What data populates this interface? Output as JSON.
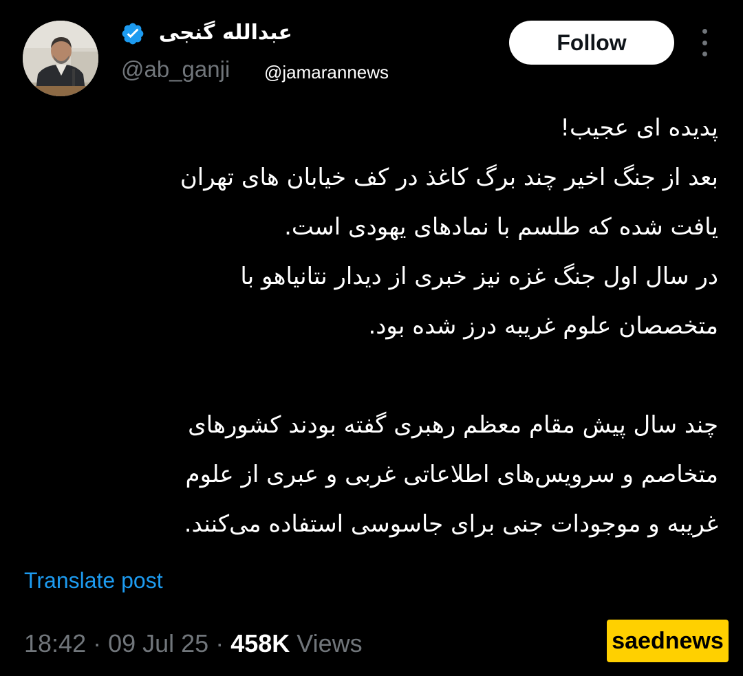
{
  "author": {
    "display_name": "عبدالله گنجی",
    "handle": "@ab_ganji",
    "avatar_icon": "profile-photo",
    "verified_icon": "verified-badge-icon"
  },
  "source_watermark": "@jamarannews",
  "actions": {
    "follow_label": "Follow",
    "more_icon": "more-vertical-icon"
  },
  "tweet": {
    "paragraph_1": "پدیده ای عجیب!\nبعد از جنگ اخیر چند برگ کاغذ در کف خیابان های تهران\nیافت شده که طلسم با نمادهای یهودی است.\nدر سال اول جنگ غزه نیز خبری از دیدار نتانیاهو با\nمتخصصان علوم غریبه درز شده بود.",
    "paragraph_2": "چند سال پیش مقام معظم رهبری گفته بودند کشورهای\nمتخاصم و سرویس‌های اطلاعاتی غربی و عبری از علوم\nغریبه و موجودات جنی برای جاسوسی استفاده می‌کنند."
  },
  "translate_label": "Translate post",
  "meta": {
    "time": "18:42",
    "separator": " · ",
    "date": "09 Jul 25",
    "views_count": "458K",
    "views_label": " Views"
  },
  "brand_badge": "saednews",
  "colors": {
    "background": "#000000",
    "text": "#ffffff",
    "muted": "#71767b",
    "link": "#1d9bf0",
    "verified": "#1d9bf0",
    "brand_bg": "#ffd000"
  }
}
